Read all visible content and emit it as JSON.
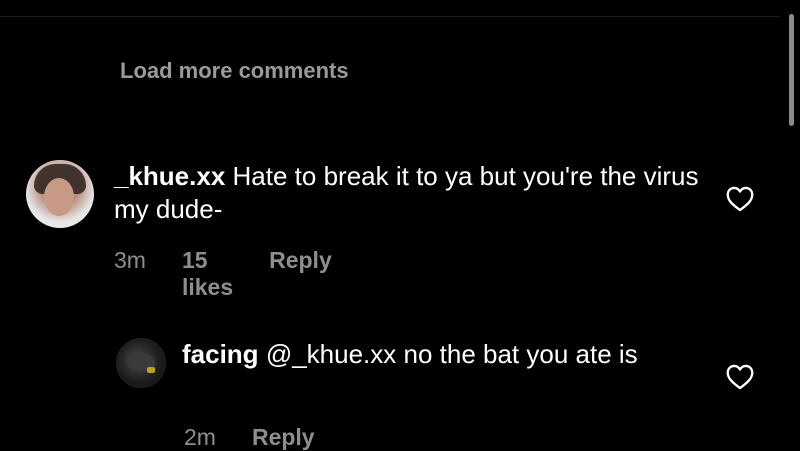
{
  "load_more": {
    "label": "Load more comments"
  },
  "comments": [
    {
      "username": "_khue.xx",
      "text": "Hate to break it to ya but you're the virus my dude-",
      "time": "3m",
      "likes": "15 likes",
      "reply_label": "Reply",
      "avatar_icon": "profile-photo",
      "like_icon": "heart-outline-icon"
    },
    {
      "username": "facing",
      "text": "@_khue.xx no the bat you ate is",
      "time": "2m",
      "reply_label": "Reply",
      "avatar_icon": "profile-photo",
      "like_icon": "heart-outline-icon"
    }
  ],
  "colors": {
    "background": "#000000",
    "text_primary": "#ffffff",
    "text_secondary": "#8e8e8e",
    "load_more": "#9a9a9a"
  }
}
